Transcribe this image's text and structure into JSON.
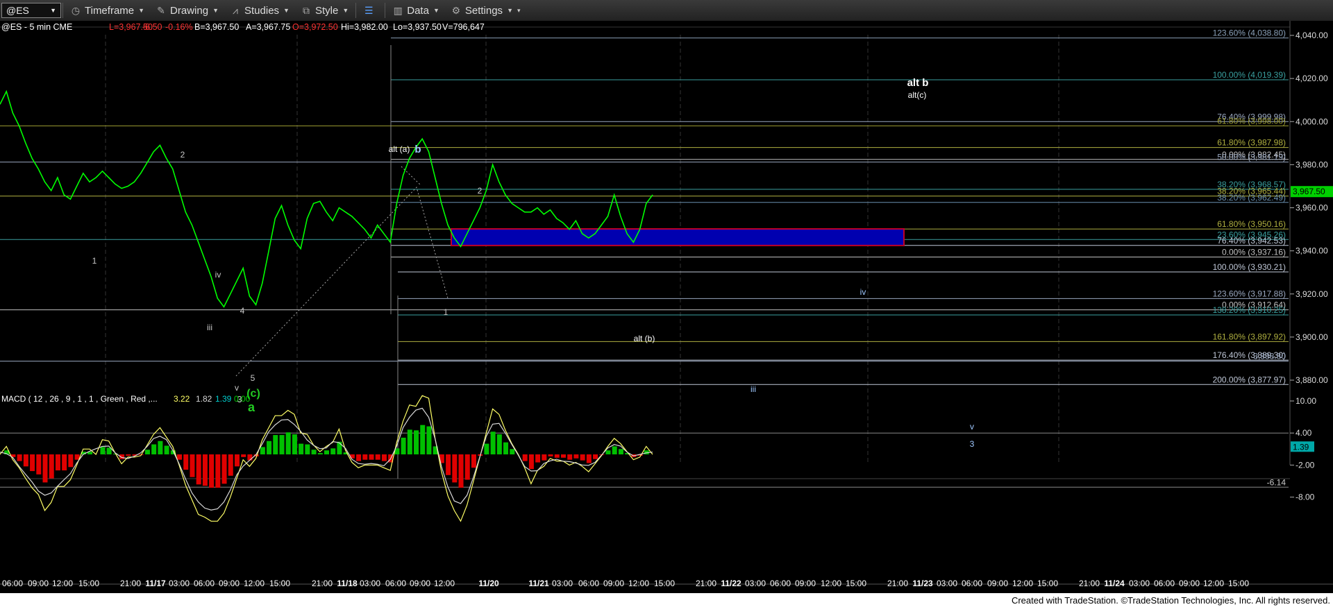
{
  "toolbar": {
    "symbol": "@ES",
    "timeframe_label": "Timeframe",
    "drawing_label": "Drawing",
    "studies_label": "Studies",
    "style_label": "Style",
    "data_label": "Data",
    "settings_label": "Settings"
  },
  "header": {
    "text": "@ES - 5 min  CME",
    "last": "L=3,967.50",
    "change": "-6.50",
    "pct": "-0.16%",
    "bid": "B=3,967.50",
    "ask": "A=3,967.75",
    "open": "O=3,972.50",
    "high": "Hi=3,982.00",
    "low": "Lo=3,937.50",
    "volume": "V=796,647"
  },
  "colors": {
    "price": "#00ff00",
    "up_text": "#ff3333",
    "blue_box": "#0000b0",
    "box_border": "#c0002a",
    "macd_line": "#ffff66",
    "signal_line": "#d8d8d8"
  },
  "price_axis": {
    "ticks": [
      {
        "value": 4040,
        "label": "4,040.00"
      },
      {
        "value": 4020,
        "label": "4,020.00"
      },
      {
        "value": 4000,
        "label": "4,000.00"
      },
      {
        "value": 3980,
        "label": "3,980.00"
      },
      {
        "value": 3960,
        "label": "3,960.00"
      },
      {
        "value": 3940,
        "label": "3,940.00"
      },
      {
        "value": 3920,
        "label": "3,920.00"
      },
      {
        "value": 3900,
        "label": "3,900.00"
      },
      {
        "value": 3880,
        "label": "3,880.00"
      }
    ],
    "last_price": "3,967.50"
  },
  "fib_levels": [
    {
      "label": "123.60% (4,038.80)",
      "value": 4038.8,
      "color": "#8aa0b8"
    },
    {
      "label": "100.00% (4,019.39)",
      "value": 4019.39,
      "color": "#3aa0a0"
    },
    {
      "label": "76.40% (3,999.98)",
      "value": 3999.98,
      "color": "#9aa8c0"
    },
    {
      "label": "61.80% (3,998.00)",
      "value": 3998.0,
      "color": "#9a9a30"
    },
    {
      "label": "61.80% (3,987.98)",
      "value": 3987.98,
      "color": "#b0b040"
    },
    {
      "label": "0.00% (3,982.45)",
      "value": 3982.45,
      "color": "#c0c0c0"
    },
    {
      "label": "50.00% (3,981.19)",
      "value": 3981.19,
      "color": "#9aa8c0"
    },
    {
      "label": "38.20% (3,968.57)",
      "value": 3968.57,
      "color": "#3aa0a0"
    },
    {
      "label": "38.20% (3,965.44)",
      "value": 3965.44,
      "color": "#b0b040"
    },
    {
      "label": "38.20% (3,962.49)",
      "value": 3962.49,
      "color": "#6a90b0"
    },
    {
      "label": "61.80% (3,950.16)",
      "value": 3950.16,
      "color": "#b0b040"
    },
    {
      "label": "23.60% (3,945.26)",
      "value": 3945.26,
      "color": "#3aa0a0"
    },
    {
      "label": "76.40% (3,942.53)",
      "value": 3942.53,
      "color": "#c0c8d8"
    },
    {
      "label": "0.00% (3,937.16)",
      "value": 3937.16,
      "color": "#c0c0c0"
    },
    {
      "label": "100.00% (3,930.21)",
      "value": 3930.21,
      "color": "#c0c8d8"
    },
    {
      "label": "123.60% (3,917.88)",
      "value": 3917.88,
      "color": "#9aa8c0"
    },
    {
      "label": "0.00% (3,912.64)",
      "value": 3912.64,
      "color": "#c0c0c0"
    },
    {
      "label": "138.20% (3,910.25)",
      "value": 3910.25,
      "color": "#3aa0a0"
    },
    {
      "label": "161.80% (3,897.92)",
      "value": 3897.92,
      "color": "#b0b040"
    },
    {
      "label": "176.40% (3,889.30)",
      "value": 3889.3,
      "color": "#c0c8d8"
    },
    {
      "label": "3,888.80",
      "value": 3888.8,
      "color": "#9aa8c0"
    },
    {
      "label": "200.00% (3,877.97)",
      "value": 3877.97,
      "color": "#c0c8d8"
    }
  ],
  "wave_labels": [
    {
      "text": "1",
      "color": "#c8c8c8"
    },
    {
      "text": "2",
      "color": "#c8c8c8"
    },
    {
      "text": "iv",
      "color": "#c8c8c8"
    },
    {
      "text": "iii",
      "color": "#c8c8c8"
    },
    {
      "text": "4",
      "color": "#c8c8c8"
    },
    {
      "text": "v",
      "color": "#c8c8c8"
    },
    {
      "text": "3",
      "color": "#c8c8c8"
    },
    {
      "text": "5",
      "color": "#c8c8c8"
    },
    {
      "text": "(c)",
      "color": "#22cc22"
    },
    {
      "text": "a",
      "color": "#22cc22"
    },
    {
      "text": "alt (a)",
      "color": "#ffffff"
    },
    {
      "text": "b",
      "color": "#9fc8ff"
    },
    {
      "text": "2",
      "color": "#c8c8c8"
    },
    {
      "text": "1",
      "color": "#c8c8c8"
    },
    {
      "text": "alt (b)",
      "color": "#ffffff"
    },
    {
      "text": "iv",
      "color": "#9fc8ff"
    },
    {
      "text": "iii",
      "color": "#9fc8ff"
    },
    {
      "text": "v",
      "color": "#9fc8ff"
    },
    {
      "text": "3",
      "color": "#9fc8ff"
    },
    {
      "text": "alt b",
      "color": "#ffffff"
    },
    {
      "text": "alt(c)",
      "color": "#ffffff"
    }
  ],
  "macd": {
    "label": "MACD ( 12 , 26 , 9 , 1 , 1 , Green , Red ,...",
    "v1": "3.22",
    "v2": "1.82",
    "v3": "1.39",
    "v4": "0.00",
    "right_badge": "1.39",
    "right_low": "-6.14",
    "ticks": [
      {
        "value": 10,
        "label": "10.00"
      },
      {
        "value": 4,
        "label": "4.00"
      },
      {
        "value": -2,
        "label": "-2.00"
      },
      {
        "value": -8,
        "label": "-8.00"
      }
    ]
  },
  "time_axis": [
    "06:00",
    "09:00",
    "12:00",
    "15:00",
    "21:00",
    "11/17",
    "03:00",
    "06:00",
    "09:00",
    "12:00",
    "15:00",
    "21:00",
    "11/18",
    "03:00",
    "06:00",
    "09:00",
    "12:00",
    "11/20",
    "11/21",
    "03:00",
    "06:00",
    "09:00",
    "12:00",
    "15:00",
    "21:00",
    "11/22",
    "03:00",
    "06:00",
    "09:00",
    "12:00",
    "15:00",
    "21:00",
    "11/23",
    "03:00",
    "06:00",
    "09:00",
    "12:00",
    "15:00",
    "21:00",
    "11/24",
    "03:00",
    "06:00",
    "09:00",
    "12:00",
    "15:00"
  ],
  "footer": "Created with TradeStation. ©TradeStation Technologies, Inc. All rights reserved.",
  "chart_data": {
    "type": "line",
    "title": "@ES - 5 min",
    "ylim": [
      3870,
      4045
    ],
    "series": [
      {
        "values": [
          4008,
          4014,
          4004,
          3998,
          3990,
          3983,
          3978,
          3972,
          3968,
          3974,
          3966,
          3964,
          3970,
          3976,
          3972,
          3974,
          3977,
          3974,
          3971,
          3969,
          3970,
          3972,
          3976,
          3981,
          3986,
          3989,
          3983,
          3978,
          3968,
          3958,
          3952,
          3944,
          3936,
          3928,
          3918,
          3914,
          3920,
          3926,
          3932,
          3919,
          3915,
          3925,
          3940,
          3955,
          3961,
          3952,
          3945,
          3941,
          3955,
          3962,
          3963,
          3958,
          3954,
          3960,
          3958,
          3956,
          3953,
          3950,
          3946,
          3952,
          3948,
          3944,
          3962,
          3975,
          3983,
          3988,
          3992,
          3986,
          3974,
          3962,
          3952,
          3946,
          3942,
          3948,
          3954,
          3960,
          3968,
          3980,
          3972,
          3966,
          3962,
          3960,
          3958,
          3958,
          3960,
          3957,
          3959,
          3955,
          3953,
          3950,
          3954,
          3948,
          3946,
          3948,
          3952,
          3956,
          3966,
          3956,
          3948,
          3944,
          3950,
          3962,
          3966
        ]
      }
    ],
    "box": {
      "low": 3942.5,
      "high": 3950.2
    }
  }
}
